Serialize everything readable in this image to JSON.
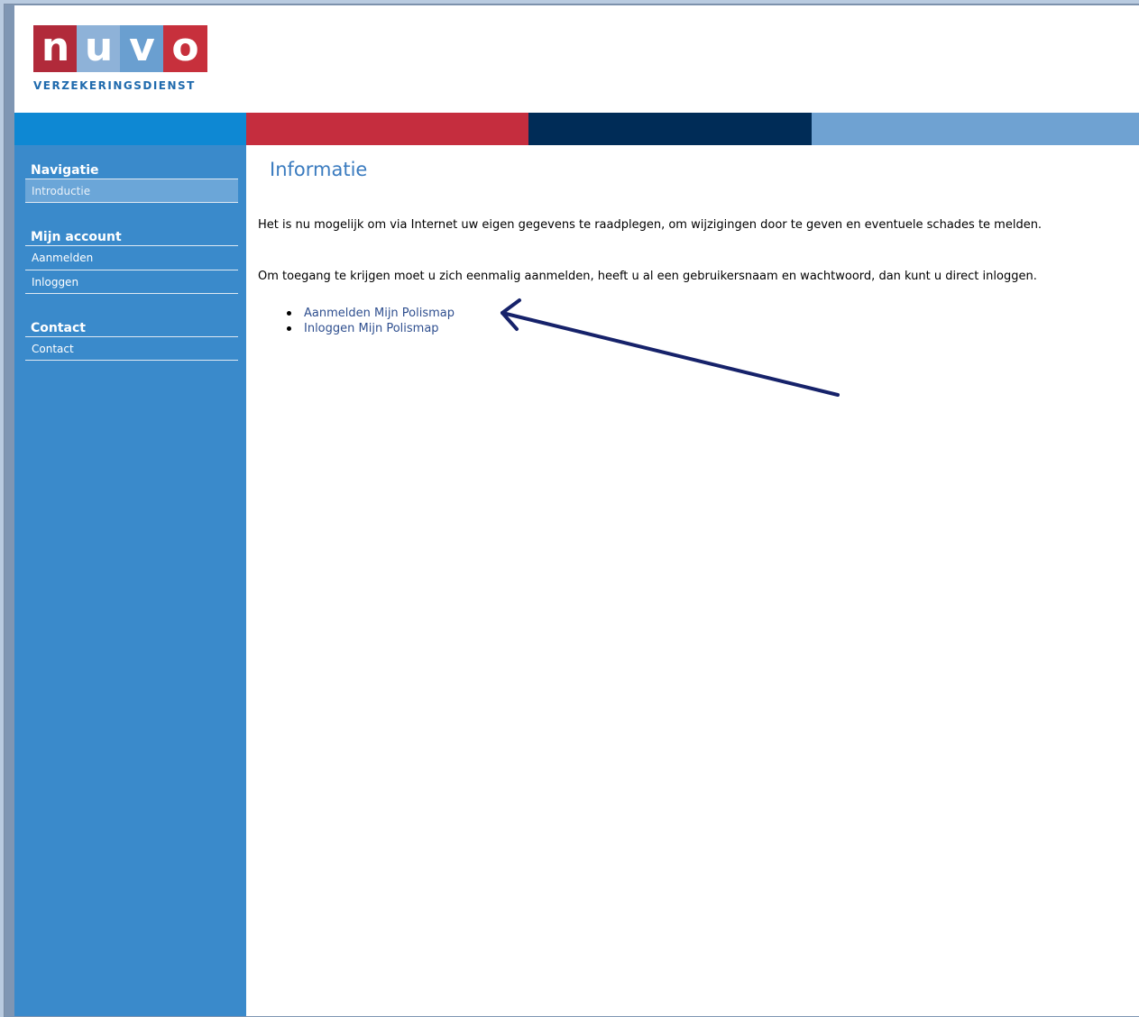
{
  "logo": {
    "letters": [
      "n",
      "u",
      "v",
      "o"
    ],
    "subtitle": "VERZEKERINGSDIENST",
    "colors": [
      "#b12a3a",
      "#8eb2d8",
      "#6a9fd0",
      "#c7303c"
    ]
  },
  "strip_colors": [
    "#0e88d3",
    "#c52d3e",
    "#002c57",
    "#6fa2d2"
  ],
  "sidebar": {
    "sections": [
      {
        "heading": "Navigatie",
        "items": [
          "Introductie"
        ]
      },
      {
        "heading": "Mijn account",
        "items": [
          "Aanmelden",
          "Inloggen"
        ]
      },
      {
        "heading": "Contact",
        "items": [
          "Contact"
        ]
      }
    ],
    "active_item": "Introductie"
  },
  "content": {
    "title": "Informatie",
    "paragraph1": "Het is nu mogelijk om via Internet uw eigen gegevens te raadplegen, om wijzigingen door te geven en eventuele schades te melden.",
    "paragraph2": "Om toegang te krijgen moet u zich eenmalig aanmelden, heeft u al een gebruikersnaam en wachtwoord, dan kunt u direct inloggen.",
    "links": [
      "Aanmelden Mijn Polismap",
      "Inloggen Mijn Polismap"
    ]
  },
  "annotation_color": "#16226a"
}
